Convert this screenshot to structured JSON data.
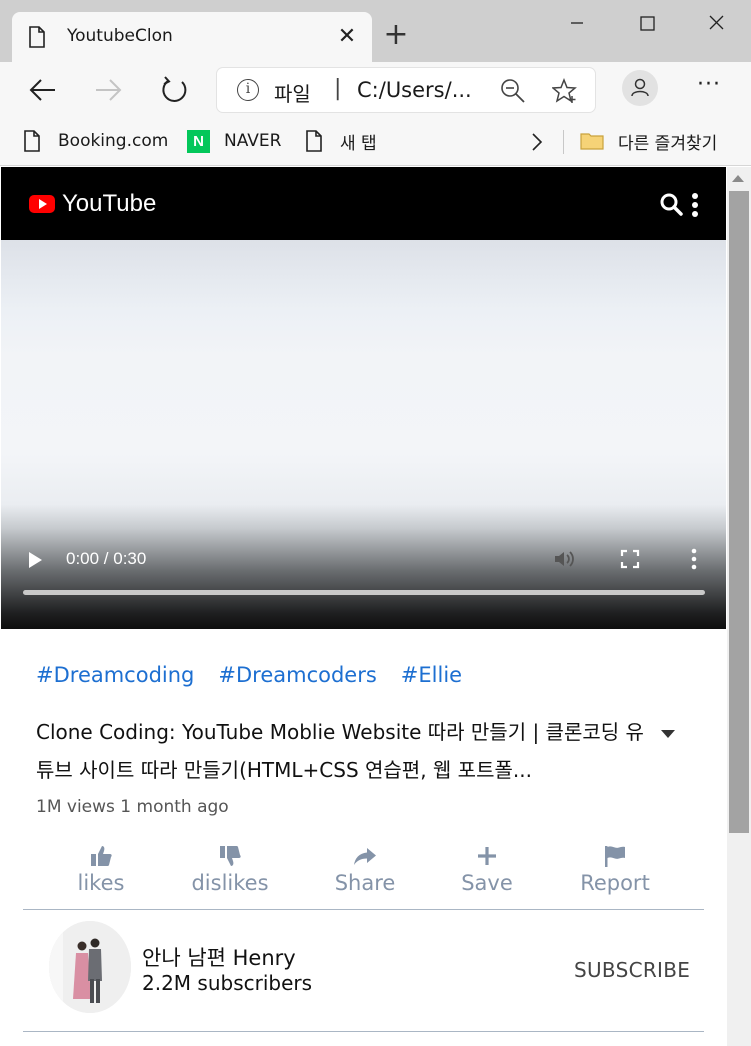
{
  "browser": {
    "tab_title": "YoutubeClon",
    "address": {
      "scheme_label": "파일",
      "separator": "|",
      "url": "C:/Users/..."
    },
    "bookmarks": [
      {
        "label": "Booking.com",
        "icon": "page-icon"
      },
      {
        "label": "NAVER",
        "icon": "naver-icon"
      },
      {
        "label": "새 탭",
        "icon": "page-icon"
      }
    ],
    "other_favorites": "다른 즐겨찾기"
  },
  "youtube": {
    "logo_text": "YouTube",
    "brand_color": "#ff0000",
    "video": {
      "time": "0:00 / 0:30",
      "progress": 0
    },
    "tags": [
      "#Dreamcoding",
      "#Dreamcoders",
      "#Ellie"
    ],
    "title": "Clone Coding: YouTube Moblie Website 따라 만들기 | 클론코딩 유튜브 사이트 따라 만들기(HTML+CSS 연습편, 웹 포트폴...",
    "meta": "1M views 1 month ago",
    "actions": [
      {
        "label": "likes",
        "icon": "thumbs-up-icon"
      },
      {
        "label": "dislikes",
        "icon": "thumbs-down-icon"
      },
      {
        "label": "Share",
        "icon": "share-icon"
      },
      {
        "label": "Save",
        "icon": "plus-icon"
      },
      {
        "label": "Report",
        "icon": "flag-icon"
      }
    ],
    "channel": {
      "name": "안나 남편 Henry",
      "subscribers": "2.2M subscribers",
      "subscribe_label": "SUBSCRIBE"
    },
    "tag_color": "#1d6fd1",
    "action_color": "#8493a8"
  }
}
